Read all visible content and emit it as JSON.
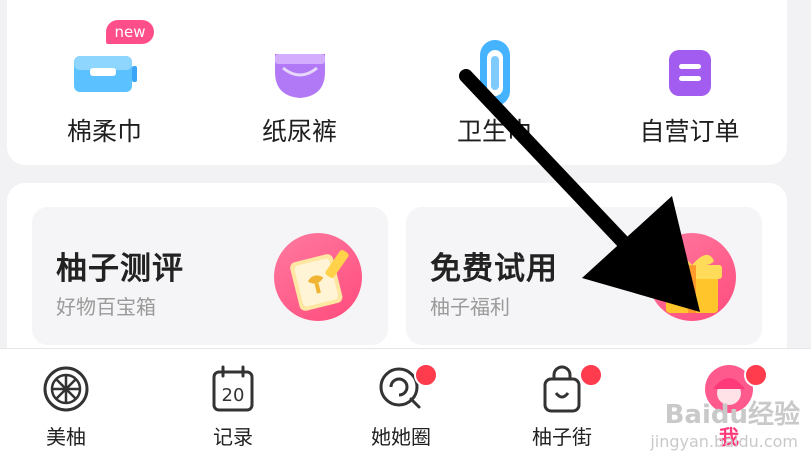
{
  "shortcuts": [
    {
      "label": "棉柔巾",
      "icon": "cotton-towel-icon",
      "badge": "new"
    },
    {
      "label": "纸尿裤",
      "icon": "diaper-icon"
    },
    {
      "label": "卫生巾",
      "icon": "sanitary-pad-icon"
    },
    {
      "label": "自营订单",
      "icon": "order-list-icon"
    }
  ],
  "features": [
    {
      "title": "柚子测评",
      "subtitle": "好物百宝箱",
      "icon": "review-note-icon"
    },
    {
      "title": "免费试用",
      "subtitle": "柚子福利",
      "icon": "gift-box-icon"
    }
  ],
  "tabbar": [
    {
      "label": "美柚",
      "icon": "grapefruit-icon"
    },
    {
      "label": "记录",
      "icon": "calendar-icon",
      "date": "20"
    },
    {
      "label": "她她圈",
      "icon": "community-icon"
    },
    {
      "label": "柚子街",
      "icon": "shopping-bag-icon"
    },
    {
      "label": "我",
      "icon": "profile-avatar-icon",
      "active": true
    }
  ],
  "watermark": {
    "brand": "Baidu经验",
    "url": "jingyan.baidu.com"
  },
  "colors": {
    "accent": "#ff4b7d",
    "active_tab": "#ff3a7a",
    "dot": "#ff3b4e",
    "purple": "#a35cf0",
    "blue": "#3aa6f5"
  }
}
